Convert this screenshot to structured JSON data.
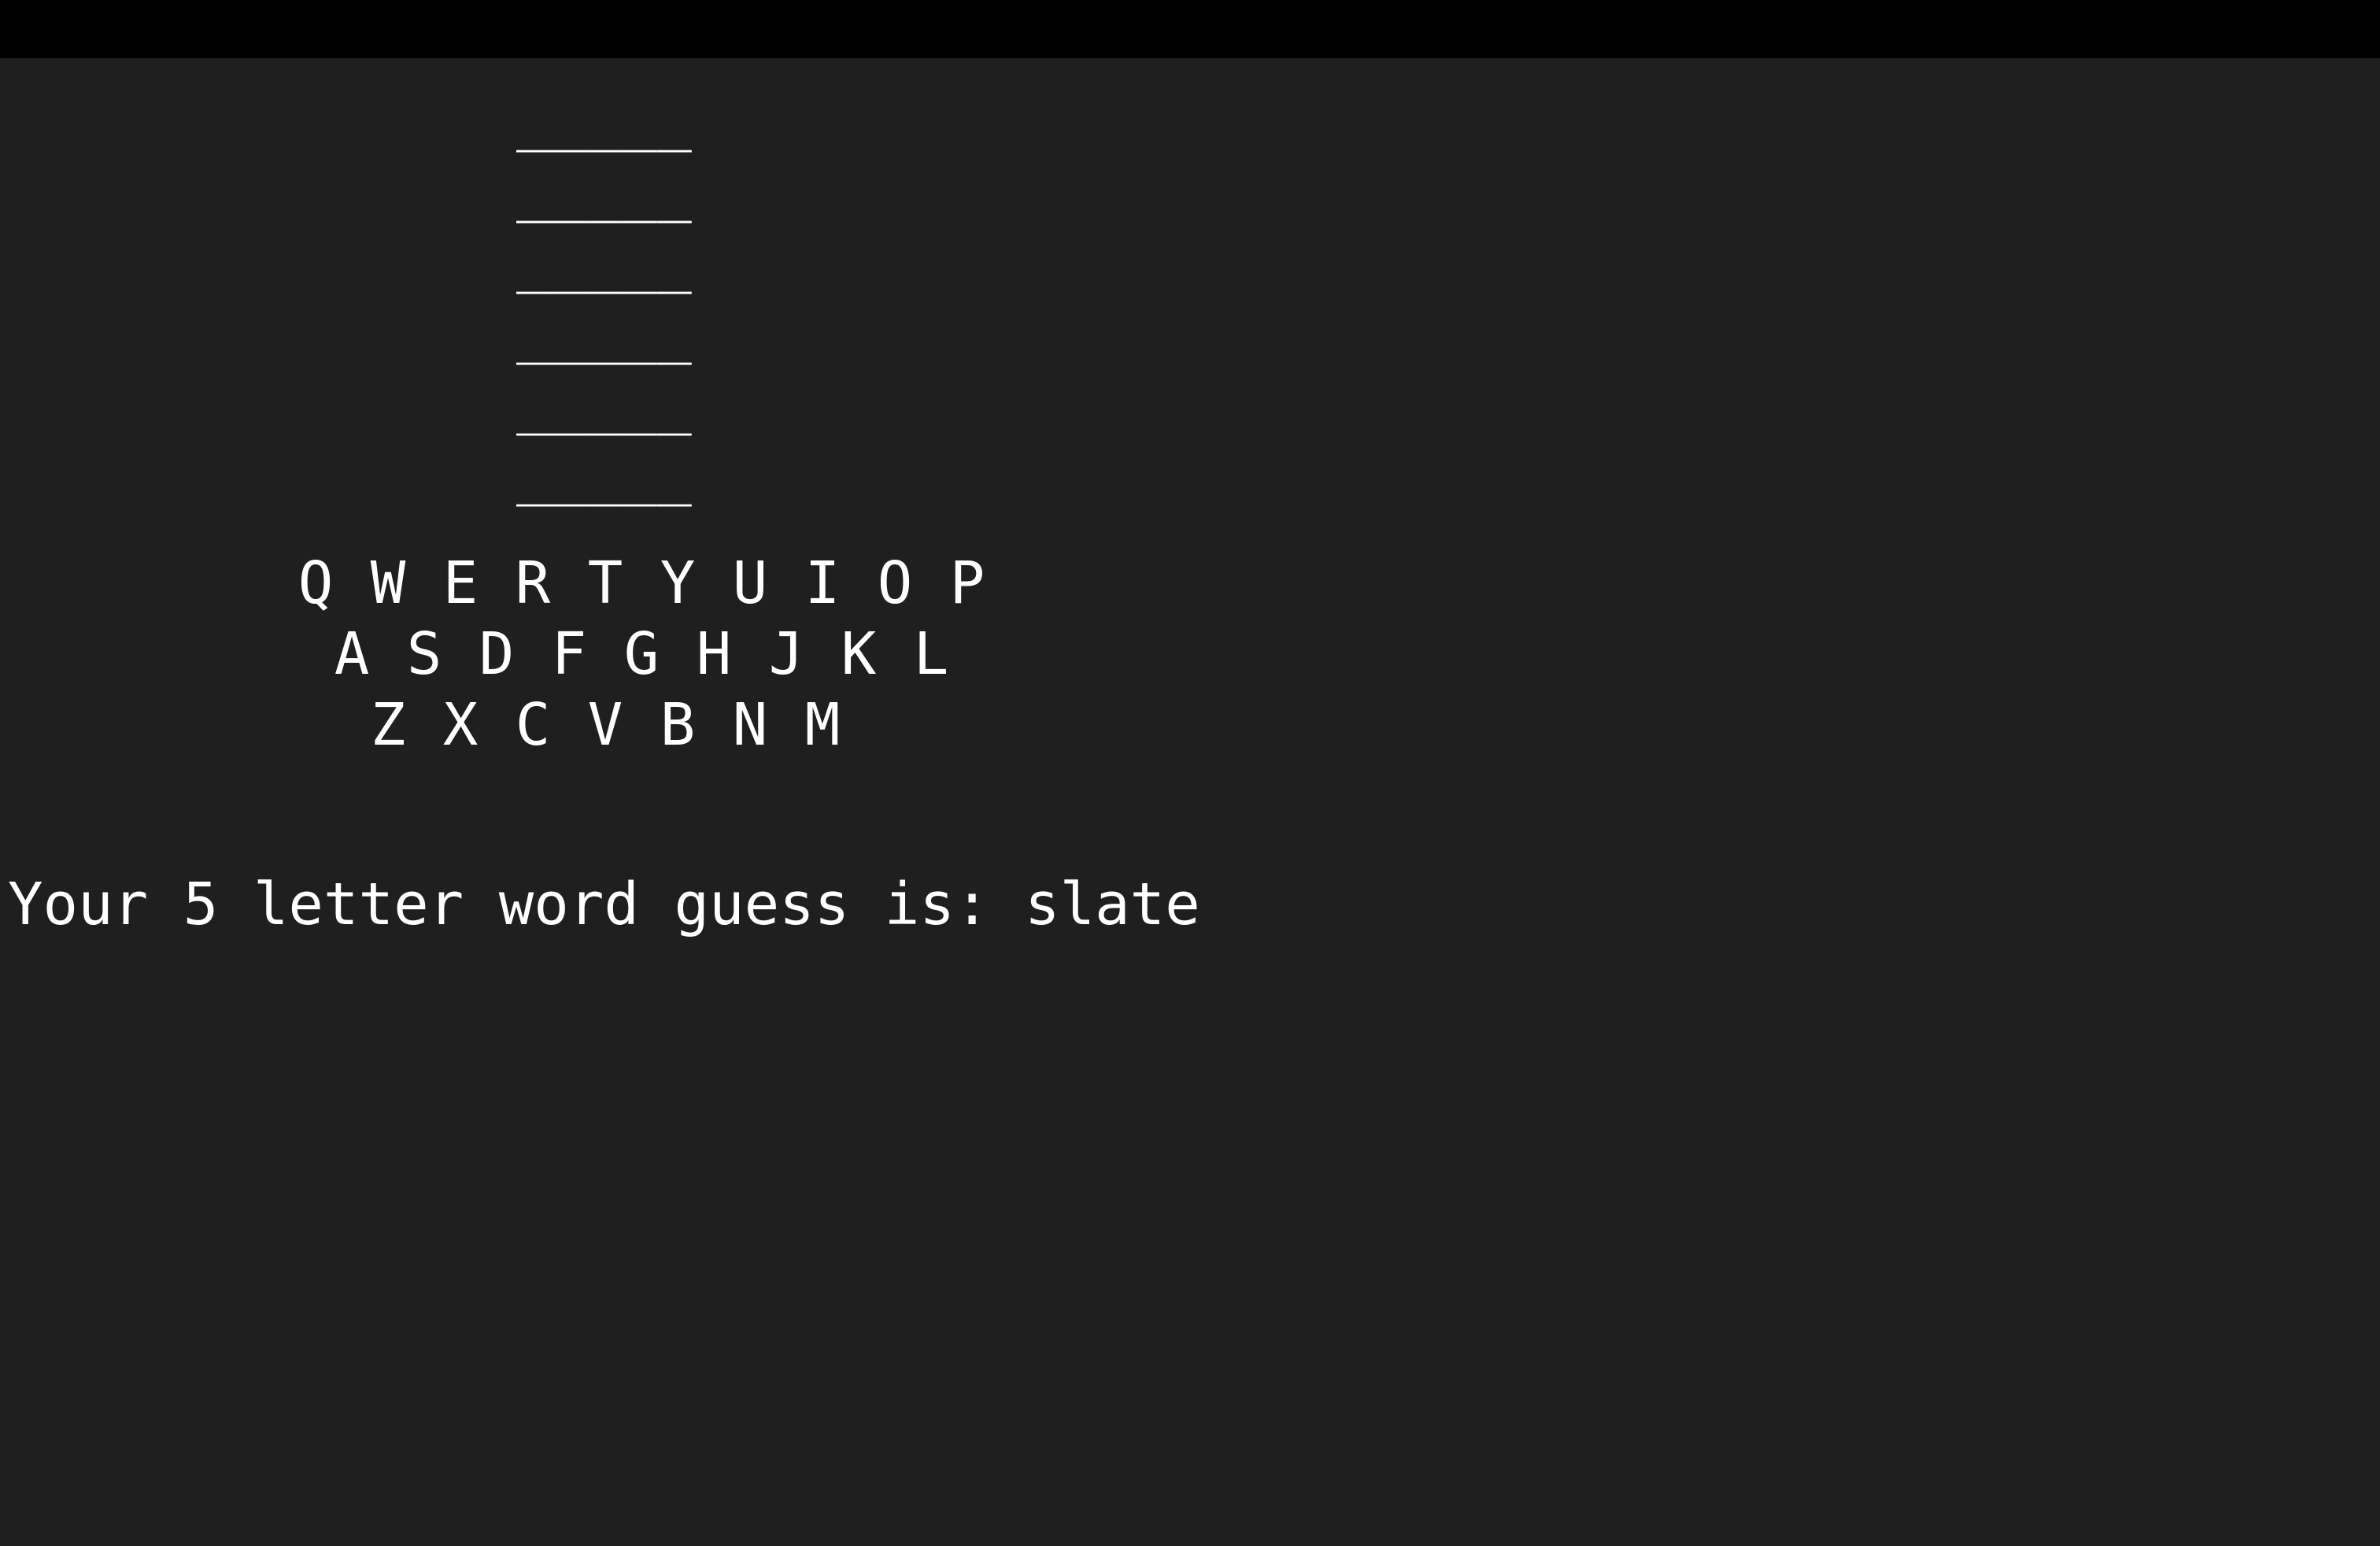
{
  "board": {
    "rows": [
      "_____",
      "_____",
      "_____",
      "_____",
      "_____",
      "_____"
    ]
  },
  "keyboard": {
    "row1": [
      "Q",
      "W",
      "E",
      "R",
      "T",
      "Y",
      "U",
      "I",
      "O",
      "P"
    ],
    "row2": [
      "A",
      "S",
      "D",
      "F",
      "G",
      "H",
      "J",
      "K",
      "L"
    ],
    "row3": [
      "Z",
      "X",
      "C",
      "V",
      "B",
      "N",
      "M"
    ]
  },
  "prompt": {
    "label": "Your 5 letter word guess is: ",
    "value": "slate"
  },
  "colors": {
    "background": "#1f1f1f",
    "top_bar": "#000000",
    "text": "#ffffff"
  }
}
